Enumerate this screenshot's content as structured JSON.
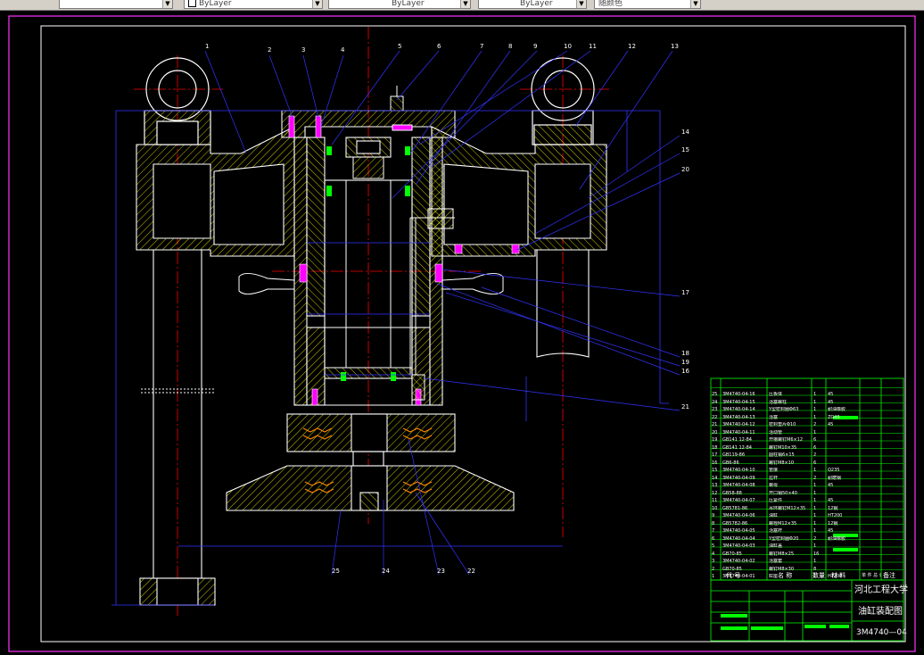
{
  "toolbar": {
    "layer_value": "",
    "color_value": "ByLayer",
    "linetype_value": "ByLayer",
    "lineweight_value": "ByLayer",
    "plotstyle_value": "随颜色"
  },
  "drawing": {
    "part_numbers": [
      "1",
      "2",
      "3",
      "4",
      "5",
      "6",
      "7",
      "8",
      "9",
      "10",
      "11",
      "12",
      "13",
      "14",
      "15",
      "16",
      "17",
      "18",
      "19",
      "20",
      "21",
      "22",
      "23",
      "24",
      "25"
    ],
    "title_block": {
      "school": "河北工程大学",
      "drawing_title": "油缸装配图",
      "drawing_number": "3M4740—04",
      "header_code": "代 号",
      "header_name": "名 称",
      "header_qty": "数量",
      "header_material": "材 料",
      "header_weight": "单 件 总 计 重 量",
      "header_remark": "备注"
    },
    "parts_list": [
      {
        "no": "25",
        "code": "3M4740-04-16",
        "name": "压板体",
        "qty": "1",
        "mat": "45"
      },
      {
        "no": "24",
        "code": "3M4740-04-15",
        "name": "活塞螺柱",
        "qty": "1",
        "mat": "45"
      },
      {
        "no": "23",
        "code": "3M4740-04-14",
        "name": "Y型密封圈Φ63",
        "qty": "1",
        "mat": "耐油橡胶"
      },
      {
        "no": "22",
        "code": "3M4740-04-13",
        "name": "活塞",
        "qty": "1",
        "mat": "ZG45"
      },
      {
        "no": "21",
        "code": "3M4740-04-12",
        "name": "密封垫片Φ10",
        "qty": "2",
        "mat": "45"
      },
      {
        "no": "20",
        "code": "3M4740-04-11",
        "name": "活动管",
        "qty": "1",
        "mat": ""
      },
      {
        "no": "19",
        "code": "GB141 12-84",
        "name": "开槽螺钉M6×12",
        "qty": "6",
        "mat": ""
      },
      {
        "no": "18",
        "code": "GB141 12-84",
        "name": "螺钉M10×35",
        "qty": "6",
        "mat": ""
      },
      {
        "no": "17",
        "code": "GB119-86",
        "name": "圆柱销6×15",
        "qty": "2",
        "mat": ""
      },
      {
        "no": "16",
        "code": "GB6-86",
        "name": "螺钉M8×10",
        "qty": "6",
        "mat": ""
      },
      {
        "no": "15",
        "code": "3M4740-04-10",
        "name": "管接",
        "qty": "1",
        "mat": "Q235"
      },
      {
        "no": "14",
        "code": "3M4740-04-09",
        "name": "拉杆",
        "qty": "2",
        "mat": "耐磨钢"
      },
      {
        "no": "13",
        "code": "3M4740-04-08",
        "name": "螺母",
        "qty": "1",
        "mat": "45"
      },
      {
        "no": "12",
        "code": "GB58-88",
        "name": "开口销50×40",
        "qty": "1",
        "mat": ""
      },
      {
        "no": "11",
        "code": "3M4740-04-07",
        "name": "压紧件",
        "qty": "1",
        "mat": "45"
      },
      {
        "no": "10",
        "code": "GB5781-86",
        "name": "吊环螺钉M12×35",
        "qty": "1",
        "mat": "12钢"
      },
      {
        "no": "9",
        "code": "3M4740-04-06",
        "name": "油缸",
        "qty": "1",
        "mat": "HT200"
      },
      {
        "no": "8",
        "code": "GB5782-86",
        "name": "螺栓M12×35",
        "qty": "1",
        "mat": "12钢"
      },
      {
        "no": "7",
        "code": "3M4740-04-05",
        "name": "活塞杆",
        "qty": "1",
        "mat": "45"
      },
      {
        "no": "6",
        "code": "3M4740-04-04",
        "name": "Y型密封圈Φ20",
        "qty": "2",
        "mat": "耐油橡胶"
      },
      {
        "no": "5",
        "code": "3M4740-04-03",
        "name": "油缸盖",
        "qty": "1",
        "mat": ""
      },
      {
        "no": "4",
        "code": "GB70-85",
        "name": "螺钉M8×25",
        "qty": "16",
        "mat": ""
      },
      {
        "no": "3",
        "code": "3M4740-04-02",
        "name": "活塞套",
        "qty": "1",
        "mat": ""
      },
      {
        "no": "2",
        "code": "GB70-85",
        "name": "螺钉M8×30",
        "qty": "8",
        "mat": ""
      },
      {
        "no": "1",
        "code": "3M4740-04-01",
        "name": "缸座",
        "qty": "1",
        "mat": "HT200"
      }
    ]
  },
  "colors": {
    "frame": "#ff33ff",
    "border": "#ffffff",
    "centerline": "#ff0000",
    "section": "#ffff00",
    "outline": "#ffffff",
    "dimension": "#3333ff",
    "title_grid": "#00ff00",
    "seal": "#00ff00",
    "spring": "#ff8800",
    "fastener": "#ff00ff"
  }
}
